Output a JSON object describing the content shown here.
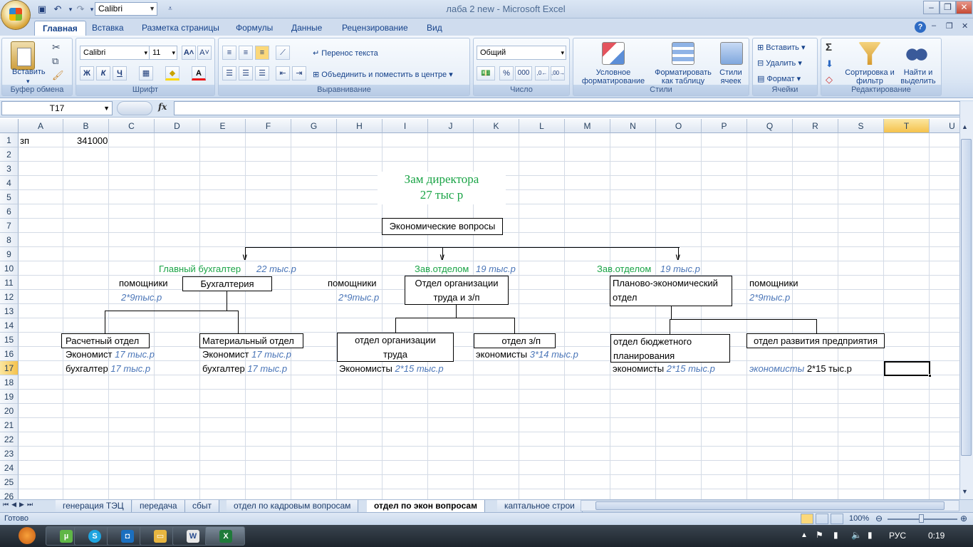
{
  "window": {
    "title": "лаба 2 new  -  Microsoft Excel",
    "qat_font": "Calibri"
  },
  "ribbon": {
    "tabs": [
      "Главная",
      "Вставка",
      "Разметка страницы",
      "Формулы",
      "Данные",
      "Рецензирование",
      "Вид"
    ],
    "clipboard": {
      "paste": "Вставить",
      "label": "Буфер обмена"
    },
    "font": {
      "name": "Calibri",
      "size": "11",
      "label": "Шрифт",
      "bold": "Ж",
      "italic": "К",
      "underline": "Ч"
    },
    "alignment": {
      "wrap": "Перенос текста",
      "merge": "Объединить и поместить в центре",
      "label": "Выравнивание"
    },
    "number": {
      "format": "Общий",
      "percent": "%",
      "thousands": "000",
      "label": "Число"
    },
    "styles": {
      "conditional": "Условное форматирование",
      "as_table": "Форматировать как таблицу",
      "cell_styles": "Стили ячеек",
      "label": "Стили"
    },
    "cells": {
      "insert": "Вставить",
      "delete": "Удалить",
      "format": "Формат",
      "label": "Ячейки"
    },
    "editing": {
      "sort": "Сортировка и фильтр",
      "find": "Найти и выделить",
      "label": "Редактирование",
      "sigma": "Σ"
    }
  },
  "formula_bar": {
    "name_box": "T17",
    "fx": "fx",
    "content": ""
  },
  "grid": {
    "columns": [
      "A",
      "B",
      "C",
      "D",
      "E",
      "F",
      "G",
      "H",
      "I",
      "J",
      "K",
      "L",
      "M",
      "N",
      "O",
      "P",
      "Q",
      "R",
      "S",
      "T",
      "U"
    ],
    "rows": [
      "1",
      "2",
      "3",
      "4",
      "5",
      "6",
      "7",
      "8",
      "9",
      "10",
      "11",
      "12",
      "13",
      "14",
      "15",
      "16",
      "17",
      "18",
      "19",
      "20",
      "21",
      "22",
      "23",
      "24",
      "25",
      "26"
    ],
    "selected_column": "T",
    "selected_row": "17",
    "a1": "зп",
    "b1": "341000",
    "director_title": "Зам директора",
    "director_salary": "27 тыс р",
    "econ_questions": "Экономические вопросы",
    "chief_accountant": "Главный бухгалтер",
    "chief_accountant_salary": "22 тыс.р",
    "head_dept_1": "Зав.отделом",
    "head_dept_1_salary": "19 тыс.р",
    "head_dept_2": "Зав.отделом",
    "head_dept_2_salary": "19 тыс.р",
    "helpers_1": "помощники",
    "helpers_1_salary": "2*9тыс.р",
    "accounting": "Бухгалтерия",
    "helpers_2": "помощники",
    "helpers_2_salary": "2*9тыс.р",
    "labor_org": "Отдел организации труда и з/п",
    "planning_econ": "Планово-экономический отдел",
    "helpers_3": "помощники",
    "helpers_3_salary": "2*9тыс.р",
    "settlement_dept": "Расчетный отдел",
    "material_dept": "Материальный отдел",
    "labor_org_dept": "отдел организации труда",
    "salary_dept": "отдел з/п",
    "budget_dept": "отдел бюджетного планирования",
    "development_dept": "отдел развития предприятия",
    "economist_1": "Экономист",
    "economist_1_salary": "17 тыс.р",
    "economist_2": "Экономист",
    "economist_2_salary": "17 тыс.р",
    "economists_3": "экономисты",
    "economists_3_salary": "3*14 тыс.р",
    "accountant_1": "бухгалтер",
    "accountant_1_salary": "17 тыс.р",
    "accountant_2": "бухгалтер",
    "accountant_2_salary": "17 тыс.р",
    "economists_4": "Экономисты",
    "economists_4_salary": "2*15 тыс.р",
    "economists_5": "экономисты",
    "economists_5_salary": "2*15 тыс.р",
    "economists_6": "экономисты",
    "economists_6_salary": "2*15 тыс.р"
  },
  "sheets": {
    "tabs": [
      "генерация ТЭЦ",
      "передача",
      "сбыт",
      "отдел по кадровым вопросам",
      "отдел по экон вопросам",
      "каптальное строи"
    ],
    "active": "отдел по экон вопросам"
  },
  "status": {
    "ready": "Готово",
    "zoom": "100%"
  },
  "taskbar": {
    "lang": "РУС",
    "time": "0:19"
  },
  "colors": {
    "green": "#1aa446",
    "blue": "#4b76b8",
    "ribbon": "#dbe6f4"
  }
}
